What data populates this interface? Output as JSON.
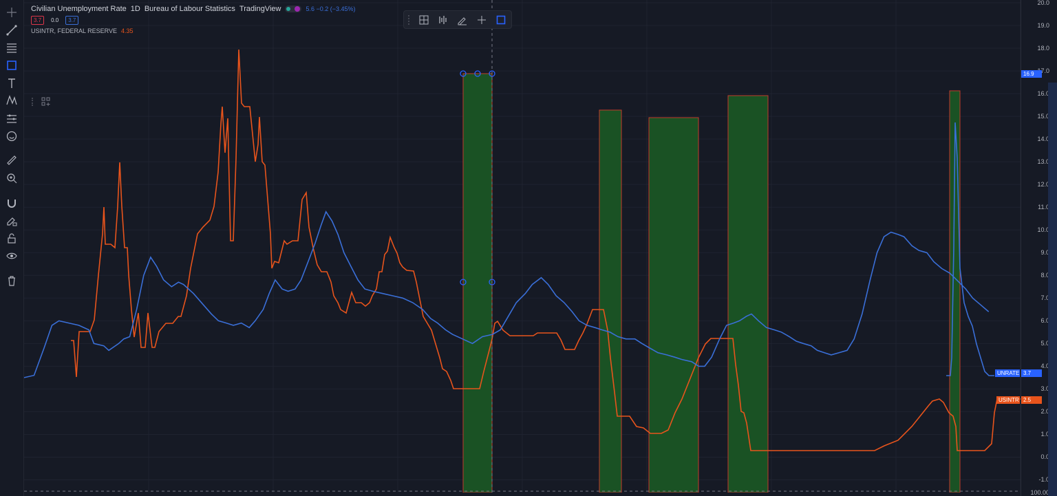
{
  "legend": {
    "title": "Civilian Unemployment Rate",
    "interval": "1D",
    "source": "Bureau of Labour Statistics",
    "platform": "TradingView",
    "change": "5.6 −0.2 (−3.45%)",
    "box_red": "3.7",
    "box_plain": "0.0",
    "box_blue": "3.7",
    "series2_label": "USINTR, FEDERAL RESERVE",
    "series2_value": "4.35"
  },
  "price_axis": {
    "unrate_label": "UNRATE",
    "unrate_value": "3.7",
    "usintr_label": "USINTR",
    "usintr_value": "2.5",
    "highlight_value": "16.9",
    "bottom_value": "100.00"
  },
  "icons": [
    "crosshair-icon",
    "trend-line-icon",
    "fib-icon",
    "rectangle-icon",
    "text-icon",
    "pattern-icon",
    "forecast-icon",
    "emoji-icon",
    "ruler-icon",
    "zoom-icon",
    "magnet-icon",
    "lock-draw-icon",
    "lock-icon",
    "eye-icon",
    "trash-icon"
  ],
  "colors": {
    "background": "#161a25",
    "unrate": "#3a6fd8",
    "usintr": "#e8541c",
    "highlight_fill": "#1a5224",
    "highlight_border": "#c23a2a",
    "grid": "#1f2330"
  },
  "chart_data": {
    "type": "line",
    "ylim": [
      -1.5,
      20.0
    ],
    "yticks": [
      -1.0,
      0.0,
      1.0,
      2.0,
      3.0,
      4.0,
      5.0,
      6.0,
      7.0,
      8.0,
      9.0,
      10.0,
      11.0,
      12.0,
      13.0,
      14.0,
      15.0,
      16.0,
      17.0,
      18.0,
      19.0,
      20.0
    ],
    "ytick_labels": [
      "-1.0",
      "0.0",
      "1.0",
      "2.0",
      "3.0",
      "4.0",
      "5.0",
      "6.0",
      "7.0",
      "8.0",
      "9.0",
      "10.0",
      "11.0",
      "12.0",
      "13.0",
      "14.0",
      "15.0",
      "16.0",
      "17.0",
      "18.0",
      "19.0",
      "20.0"
    ],
    "xlim": [
      0,
      100
    ],
    "series": [
      {
        "name": "UNRATE",
        "color": "#3a6fd8",
        "points": [
          [
            0,
            3.5
          ],
          [
            1,
            3.6
          ],
          [
            2,
            4.8
          ],
          [
            2.8,
            5.8
          ],
          [
            3.5,
            6.0
          ],
          [
            4.5,
            5.9
          ],
          [
            5.5,
            5.8
          ],
          [
            6.5,
            5.6
          ],
          [
            7,
            5.0
          ],
          [
            8,
            4.9
          ],
          [
            8.5,
            4.7
          ],
          [
            9.5,
            5.0
          ],
          [
            10,
            5.2
          ],
          [
            10.6,
            5.3
          ],
          [
            11.3,
            6.5
          ],
          [
            12,
            8.0
          ],
          [
            12.7,
            8.8
          ],
          [
            13.3,
            8.4
          ],
          [
            14,
            7.8
          ],
          [
            14.8,
            7.5
          ],
          [
            15.5,
            7.7
          ],
          [
            16,
            7.6
          ],
          [
            17,
            7.2
          ],
          [
            18,
            6.7
          ],
          [
            18.8,
            6.3
          ],
          [
            19.5,
            6.0
          ],
          [
            20.3,
            5.9
          ],
          [
            21,
            5.8
          ],
          [
            21.8,
            5.9
          ],
          [
            22.6,
            5.7
          ],
          [
            23.2,
            6.0
          ],
          [
            24,
            6.5
          ],
          [
            24.6,
            7.2
          ],
          [
            25.2,
            7.8
          ],
          [
            25.9,
            7.4
          ],
          [
            26.5,
            7.3
          ],
          [
            27.2,
            7.4
          ],
          [
            27.8,
            7.8
          ],
          [
            28.5,
            8.6
          ],
          [
            29.2,
            9.4
          ],
          [
            29.8,
            10.2
          ],
          [
            30.3,
            10.8
          ],
          [
            30.9,
            10.4
          ],
          [
            31.5,
            9.8
          ],
          [
            32.1,
            9.0
          ],
          [
            32.8,
            8.4
          ],
          [
            33.5,
            7.8
          ],
          [
            34.2,
            7.4
          ],
          [
            35,
            7.3
          ],
          [
            36,
            7.2
          ],
          [
            37,
            7.1
          ],
          [
            38,
            7.0
          ],
          [
            39,
            6.8
          ],
          [
            40,
            6.5
          ],
          [
            40.8,
            6.1
          ],
          [
            41.5,
            5.9
          ],
          [
            42.3,
            5.6
          ],
          [
            43,
            5.4
          ],
          [
            44,
            5.2
          ],
          [
            45,
            5.0
          ],
          [
            46,
            5.3
          ],
          [
            47,
            5.4
          ],
          [
            47.8,
            5.6
          ],
          [
            48.6,
            6.2
          ],
          [
            49.4,
            6.8
          ],
          [
            50.3,
            7.2
          ],
          [
            51,
            7.6
          ],
          [
            51.9,
            7.9
          ],
          [
            52.6,
            7.6
          ],
          [
            53.4,
            7.1
          ],
          [
            54.2,
            6.8
          ],
          [
            55,
            6.4
          ],
          [
            55.7,
            6.0
          ],
          [
            56.5,
            5.8
          ],
          [
            57.3,
            5.7
          ],
          [
            58,
            5.6
          ],
          [
            58.8,
            5.5
          ],
          [
            59.6,
            5.3
          ],
          [
            60.4,
            5.2
          ],
          [
            61.3,
            5.2
          ],
          [
            62,
            5.0
          ],
          [
            62.8,
            4.8
          ],
          [
            63.6,
            4.6
          ],
          [
            64.5,
            4.5
          ],
          [
            65.3,
            4.4
          ],
          [
            66,
            4.3
          ],
          [
            67,
            4.2
          ],
          [
            67.7,
            4.0
          ],
          [
            68.3,
            4.0
          ],
          [
            69,
            4.4
          ],
          [
            69.8,
            5.2
          ],
          [
            70.5,
            5.8
          ],
          [
            71.2,
            5.9
          ],
          [
            71.8,
            6.0
          ],
          [
            72.5,
            6.2
          ],
          [
            73,
            6.3
          ],
          [
            73.7,
            6.0
          ],
          [
            74.5,
            5.7
          ],
          [
            75.3,
            5.6
          ],
          [
            76,
            5.5
          ],
          [
            76.8,
            5.3
          ],
          [
            77.5,
            5.1
          ],
          [
            78.2,
            5.0
          ],
          [
            79,
            4.9
          ],
          [
            79.6,
            4.7
          ],
          [
            80.3,
            4.6
          ],
          [
            81,
            4.5
          ],
          [
            81.8,
            4.6
          ],
          [
            82.6,
            4.7
          ],
          [
            83.3,
            5.2
          ],
          [
            84.1,
            6.3
          ],
          [
            84.9,
            7.8
          ],
          [
            85.6,
            9.0
          ],
          [
            86.3,
            9.7
          ],
          [
            87,
            9.9
          ],
          [
            87.7,
            9.8
          ],
          [
            88.3,
            9.7
          ],
          [
            89.1,
            9.3
          ],
          [
            89.8,
            9.1
          ],
          [
            90.6,
            9.0
          ],
          [
            91.3,
            8.6
          ],
          [
            92.1,
            8.3
          ],
          [
            92.9,
            8.1
          ],
          [
            93.6,
            7.8
          ],
          [
            94.5,
            7.4
          ],
          [
            95.2,
            7.0
          ],
          [
            96,
            6.7
          ],
          [
            96.8,
            6.4
          ],
          [
            97.6,
            6.0
          ],
          [
            98.4,
            5.8
          ],
          [
            99.2,
            5.6
          ],
          [
            100,
            5.4
          ]
        ]
      }
    ]
  }
}
